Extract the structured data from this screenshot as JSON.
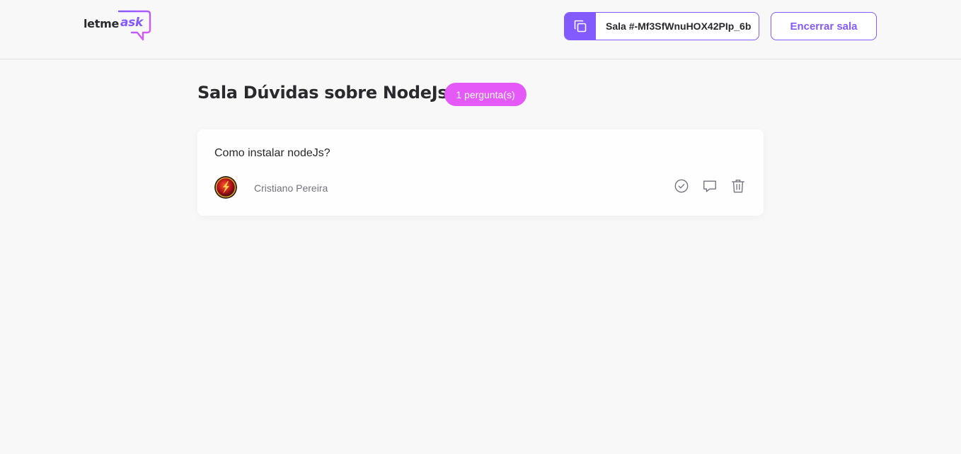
{
  "header": {
    "logo": {
      "text_main": "letme",
      "text_accent": "ask"
    },
    "room_code": {
      "label": "Sala #-Mf3SfWnuHOX42PIp_6b",
      "icon": "copy-icon"
    },
    "close_button_label": "Encerrar sala"
  },
  "main": {
    "room_title": "Sala Dúvidas sobre NodeJs",
    "question_count_badge": "1 pergunta(s)",
    "questions": [
      {
        "content": "Como instalar nodeJs?",
        "author": "Cristiano Pereira",
        "actions": [
          "check-circle-icon",
          "answer-bubble-icon",
          "trash-icon"
        ]
      }
    ]
  },
  "colors": {
    "accent": "#835afd",
    "badge": "#e559f9",
    "background": "#f8f8f8",
    "text": "#29292e",
    "muted": "#737380"
  }
}
